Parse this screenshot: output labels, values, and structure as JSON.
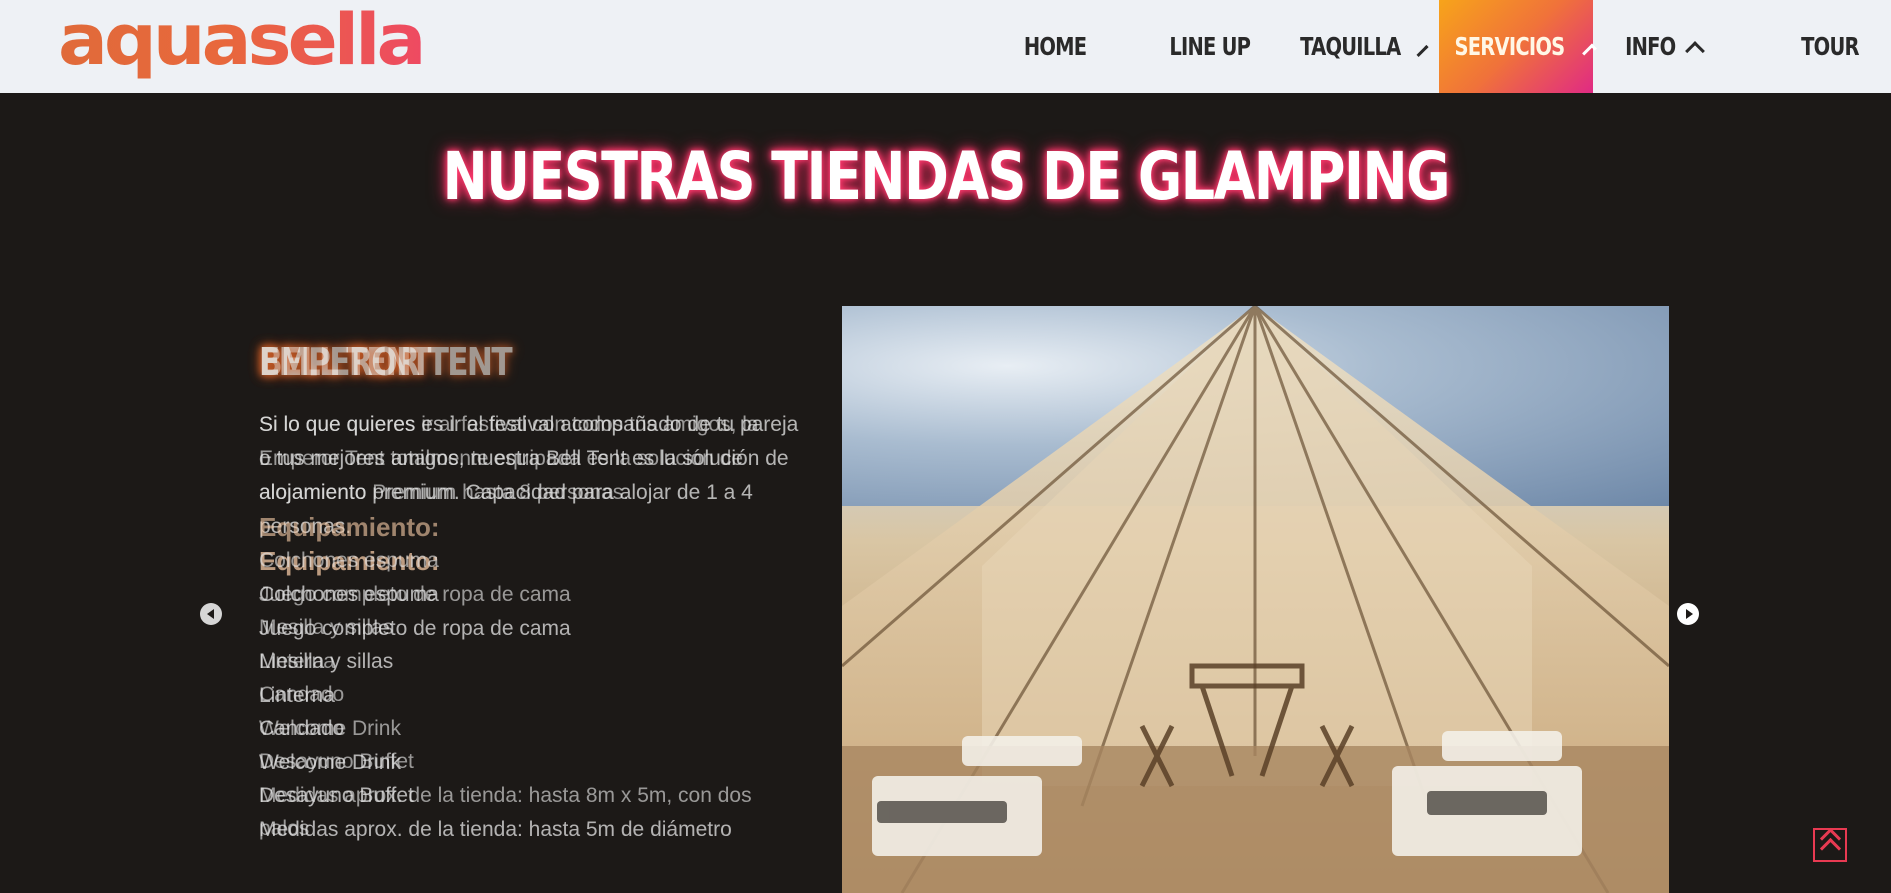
{
  "brand": {
    "logo_text": "aquasella"
  },
  "nav": {
    "items": [
      {
        "label": "HOME",
        "dropdown": false,
        "active": false
      },
      {
        "label": "LINE UP",
        "dropdown": false,
        "active": false
      },
      {
        "label": "TAQUILLA",
        "dropdown": true,
        "active": false
      },
      {
        "label": "SERVICIOS",
        "dropdown": true,
        "active": true
      },
      {
        "label": "INFO",
        "dropdown": true,
        "active": false
      },
      {
        "label": "TOUR",
        "dropdown": false,
        "active": false
      }
    ]
  },
  "page": {
    "heading": "NUESTRAS TIENDAS DE GLAMPING"
  },
  "slides": [
    {
      "title": "BELL TENT",
      "description": "Si lo que quieres es ir al festival acompañado de tu pareja o tus mejores amigos, nuestra Bell Tent es la solución de alojamiento premium. Capacidad para alojar de 1 a 4 personas.",
      "equip_title": "Equipamiento:",
      "equipment": [
        "Colchones espuma",
        "Juego completo de ropa de cama",
        "Mesilla y sillas",
        "Linterna",
        "Candado",
        "Welcome Drink",
        "Desayuno Buffet",
        "Medidas aprox. de la tienda: hasta 5m de diámetro"
      ]
    },
    {
      "title": "EMPEROR TENT",
      "description": "Si lo que quieres ir al festival con todos tus amigos, la Emperor Tent totalmente equipada es la solución de alojamiento Premium hasta 8 personas.",
      "equip_title": "Equipamiento:",
      "equipment": [
        "Colchones espuma",
        "Juego completo de ropa de cama",
        "Mesilla y sillas",
        "Linterna",
        "Candado",
        "Welcome Drink",
        "Desayuno Buffet",
        "Medidas aprox. de la tienda: hasta 8m x 5m, con dos palos"
      ]
    }
  ],
  "controls": {
    "prev_icon": "chevron-left-icon",
    "next_icon": "chevron-right-icon",
    "scroll_top_icon": "double-chevron-up-icon"
  },
  "colors": {
    "nav_bg": "#eef1f5",
    "page_bg": "#1c1917",
    "active_gradient_start": "#f7a41a",
    "active_gradient_end": "#e02a84",
    "heading_glow": "#ff3a6e",
    "title_glow": "#e46a2c",
    "scroll_top": "#e83a52"
  }
}
